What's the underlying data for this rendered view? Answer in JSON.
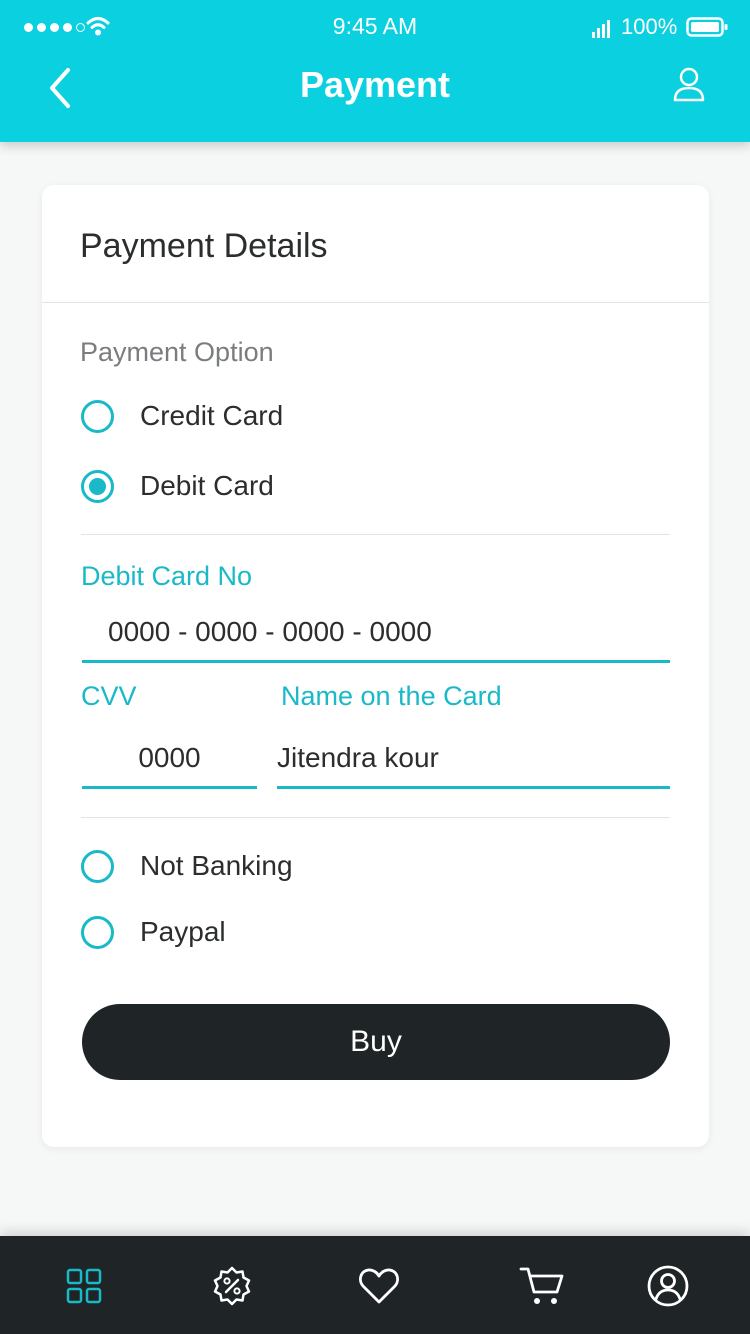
{
  "status_bar": {
    "time": "9:45 AM",
    "battery": "100%"
  },
  "header": {
    "title": "Payment",
    "back_icon": "chevron-left-icon",
    "profile_icon": "user-icon"
  },
  "card": {
    "title": "Payment Details",
    "section_label": "Payment Option",
    "options": [
      {
        "label": "Credit Card",
        "selected": false
      },
      {
        "label": "Debit Card",
        "selected": true
      },
      {
        "label": "Not Banking",
        "selected": false
      },
      {
        "label": "Paypal",
        "selected": false
      }
    ],
    "fields": {
      "card_no": {
        "label": "Debit Card No",
        "value": "0000 - 0000 - 0000 - 0000"
      },
      "cvv": {
        "label": "CVV",
        "value": "0000"
      },
      "name": {
        "label": "Name on the Card",
        "value": "Jitendra kour"
      }
    },
    "buy_label": "Buy"
  },
  "tab_bar": {
    "tabs": [
      {
        "icon": "grid-icon",
        "active": true
      },
      {
        "icon": "discount-badge-icon",
        "active": false
      },
      {
        "icon": "heart-icon",
        "active": false
      },
      {
        "icon": "cart-icon",
        "active": false
      },
      {
        "icon": "account-icon",
        "active": false
      }
    ]
  },
  "colors": {
    "header": "#0bd0df",
    "accent": "#19b9c8",
    "dark": "#1f2426",
    "background": "#f6f7f7"
  }
}
